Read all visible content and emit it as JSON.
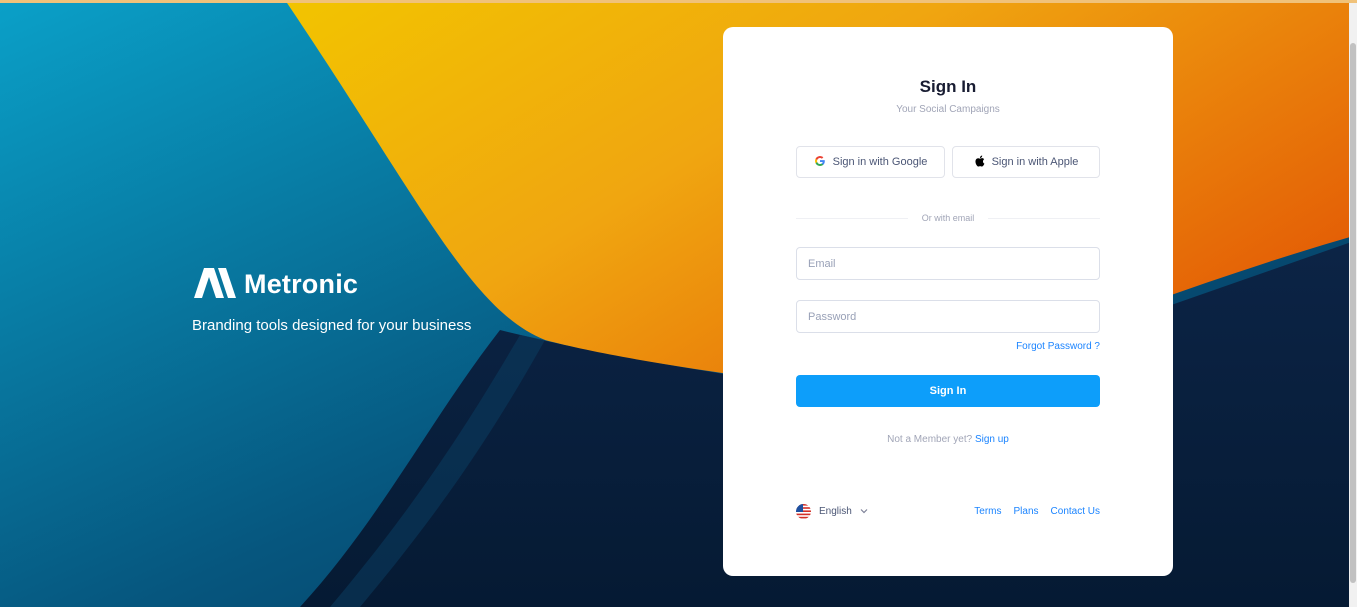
{
  "colors": {
    "accent": "#0d9efa",
    "link": "#1b84ff",
    "title": "#181c32",
    "muted": "#a1a5b7",
    "background_teal": "#0b8fb8",
    "background_orange": "#f0a020",
    "background_navy": "#0a2c4a"
  },
  "brand": {
    "logo_icon": "metronic-logo-icon",
    "name": "Metronic",
    "tagline": "Branding tools designed for your business"
  },
  "form": {
    "title": "Sign In",
    "subtitle": "Your Social Campaigns",
    "google_label": "Sign in with Google",
    "google_icon": "google-icon",
    "apple_label": "Sign in with Apple",
    "apple_icon": "apple-icon",
    "divider_text": "Or with email",
    "email_placeholder": "Email",
    "email_value": "",
    "password_placeholder": "Password",
    "password_value": "",
    "forgot_label": "Forgot Password ?",
    "submit_label": "Sign In",
    "member_text": "Not a Member yet?",
    "signup_label": "Sign up"
  },
  "footer": {
    "language": "English",
    "language_icon": "us-flag-icon",
    "links": [
      "Terms",
      "Plans",
      "Contact Us"
    ]
  }
}
